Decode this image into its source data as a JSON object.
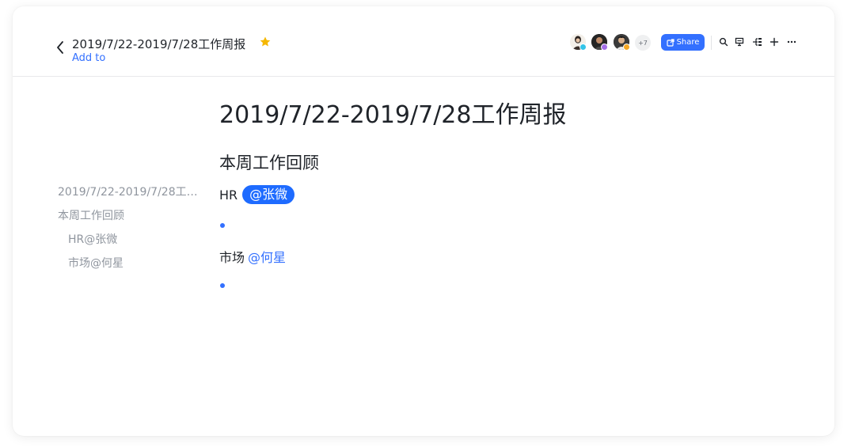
{
  "header": {
    "doc_title": "2019/7/22-2019/7/28工作周报",
    "add_to": "Add to",
    "collaborator_extra_count": "+7",
    "share_label": "Share",
    "star_color": "#f5b700"
  },
  "outline": {
    "items": [
      {
        "label": "2019/7/22-2019/7/28工作周报"
      },
      {
        "label": "本周工作回顾"
      },
      {
        "label": "HR@张微"
      },
      {
        "label": "市场@何星"
      }
    ]
  },
  "document": {
    "title": "2019/7/22-2019/7/28工作周报",
    "section_heading": "本周工作回顾",
    "entries": [
      {
        "label": "HR",
        "mention": "@张微"
      },
      {
        "label": "市场",
        "mention": "@何星"
      }
    ]
  },
  "colors": {
    "accent": "#3370ff",
    "mention_highlight": "#1e6bff"
  }
}
